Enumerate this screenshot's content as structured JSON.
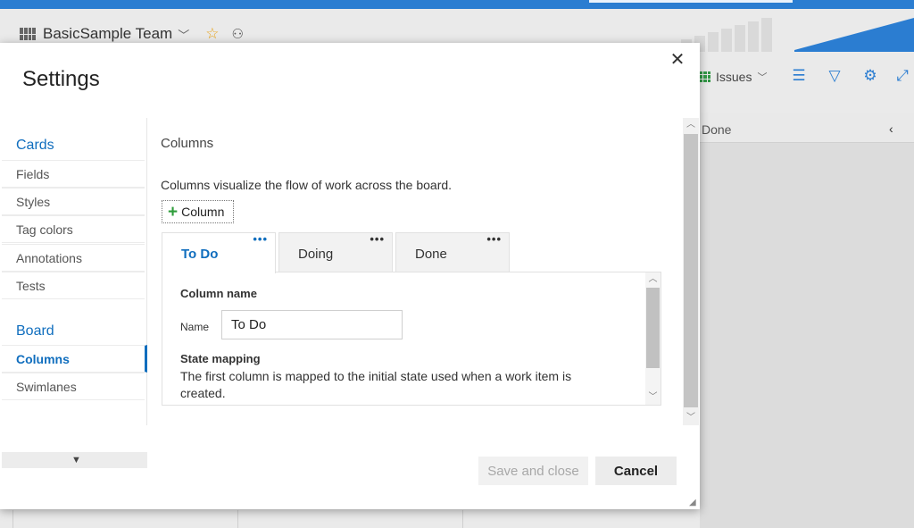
{
  "background": {
    "team_name": "BasicSample Team",
    "toolbar": {
      "issues_label": "Issues"
    },
    "column_header": "Done"
  },
  "dialog": {
    "title": "Settings",
    "close_glyph": "✕",
    "nav": {
      "sections": [
        {
          "label": "Cards",
          "items": [
            "Fields",
            "Styles",
            "Tag colors",
            "Annotations",
            "Tests"
          ]
        },
        {
          "label": "Board",
          "items": [
            "Columns",
            "Swimlanes"
          ]
        }
      ],
      "active_item": "Columns"
    },
    "content": {
      "section_title": "Columns",
      "description": "Columns visualize the flow of work across the board.",
      "add_column_label": "Column",
      "tabs": [
        {
          "label": "To Do",
          "active": true
        },
        {
          "label": "Doing",
          "active": false
        },
        {
          "label": "Done",
          "active": false
        }
      ],
      "panel": {
        "column_name_heading": "Column name",
        "name_label": "Name",
        "name_value": "To Do",
        "state_mapping_heading": "State mapping",
        "state_mapping_text": "The first column is mapped to the initial state used when a work item is created."
      }
    },
    "buttons": {
      "save_and_close": "Save and close",
      "cancel": "Cancel"
    }
  },
  "colors": {
    "accent": "#106ebe",
    "plus_green": "#2e9c3a",
    "top_bar": "#2b7dd1"
  }
}
